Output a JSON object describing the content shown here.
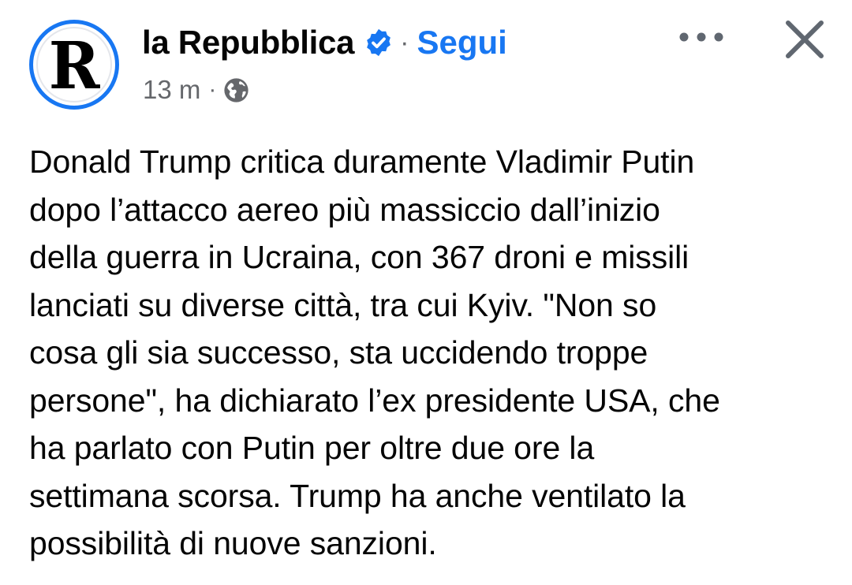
{
  "post": {
    "author": {
      "name": "la Repubblica",
      "avatar_letter": "R",
      "verified": true
    },
    "follow_label": "Segui",
    "separator": "·",
    "timestamp": "13 m",
    "audience_icon": "globe-icon",
    "text_lines": [
      "Donald Trump critica duramente Vladimir Putin",
      "dopo l’attacco aereo più massiccio dall’inizio",
      "della guerra in Ucraina, con 367 droni e missili",
      "lanciati su diverse città, tra cui Kyiv. \"Non so",
      "cosa gli sia successo, sta uccidendo troppe",
      "persone\", ha dichiarato l’ex presidente USA, che",
      "ha parlato con Putin per oltre due ore la",
      "settimana scorsa. Trump ha anche ventilato la",
      "possibilità di nuove sanzioni."
    ]
  },
  "icons": {
    "more": "more-horizontal-icon",
    "close": "close-icon",
    "verified": "verified-badge-icon"
  },
  "colors": {
    "accent": "#1877f2",
    "text": "#050505",
    "secondary_text": "#65676b",
    "icon_gray": "#606770"
  }
}
